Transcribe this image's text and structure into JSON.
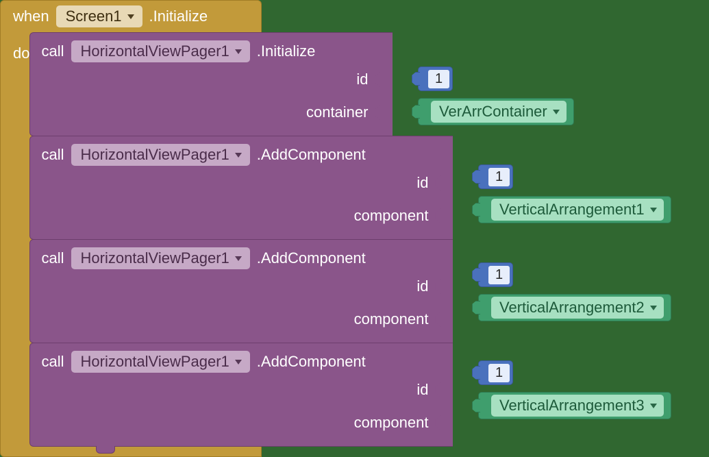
{
  "event": {
    "when": "when",
    "screen": "Screen1",
    "method_suffix": ".Initialize",
    "do": "do"
  },
  "calls": [
    {
      "call": "call",
      "target": "HorizontalViewPager1",
      "method": ".Initialize",
      "params": [
        {
          "label": "id",
          "kind": "number",
          "value": "1"
        },
        {
          "label": "container",
          "kind": "component",
          "value": "VerArrContainer"
        }
      ]
    },
    {
      "call": "call",
      "target": "HorizontalViewPager1",
      "method": ".AddComponent",
      "params": [
        {
          "label": "id",
          "kind": "number",
          "value": "1"
        },
        {
          "label": "component",
          "kind": "component",
          "value": "VerticalArrangement1"
        }
      ]
    },
    {
      "call": "call",
      "target": "HorizontalViewPager1",
      "method": ".AddComponent",
      "params": [
        {
          "label": "id",
          "kind": "number",
          "value": "1"
        },
        {
          "label": "component",
          "kind": "component",
          "value": "VerticalArrangement2"
        }
      ]
    },
    {
      "call": "call",
      "target": "HorizontalViewPager1",
      "method": ".AddComponent",
      "params": [
        {
          "label": "id",
          "kind": "number",
          "value": "1"
        },
        {
          "label": "component",
          "kind": "component",
          "value": "VerticalArrangement3"
        }
      ]
    }
  ]
}
